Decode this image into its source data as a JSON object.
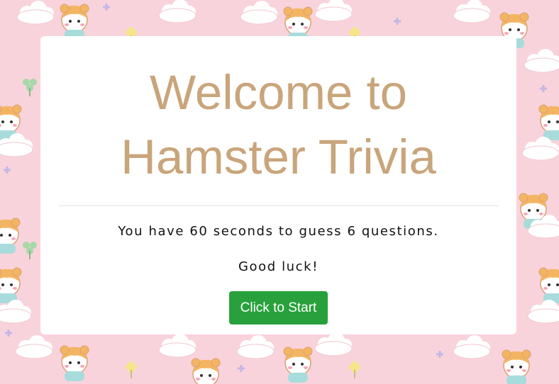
{
  "page": {
    "background_color": "#f9d3dc",
    "background_pattern": "hamster-cloud-wallpaper"
  },
  "welcome": {
    "title_line1": "Welcome to",
    "title_line2": "Hamster Trivia",
    "title_color": "#c9a57b",
    "instructions": "You have 60 seconds to guess 6 questions.",
    "good_luck": "Good luck!",
    "start_button_label": "Click to Start",
    "start_button_color": "#28a03c"
  }
}
